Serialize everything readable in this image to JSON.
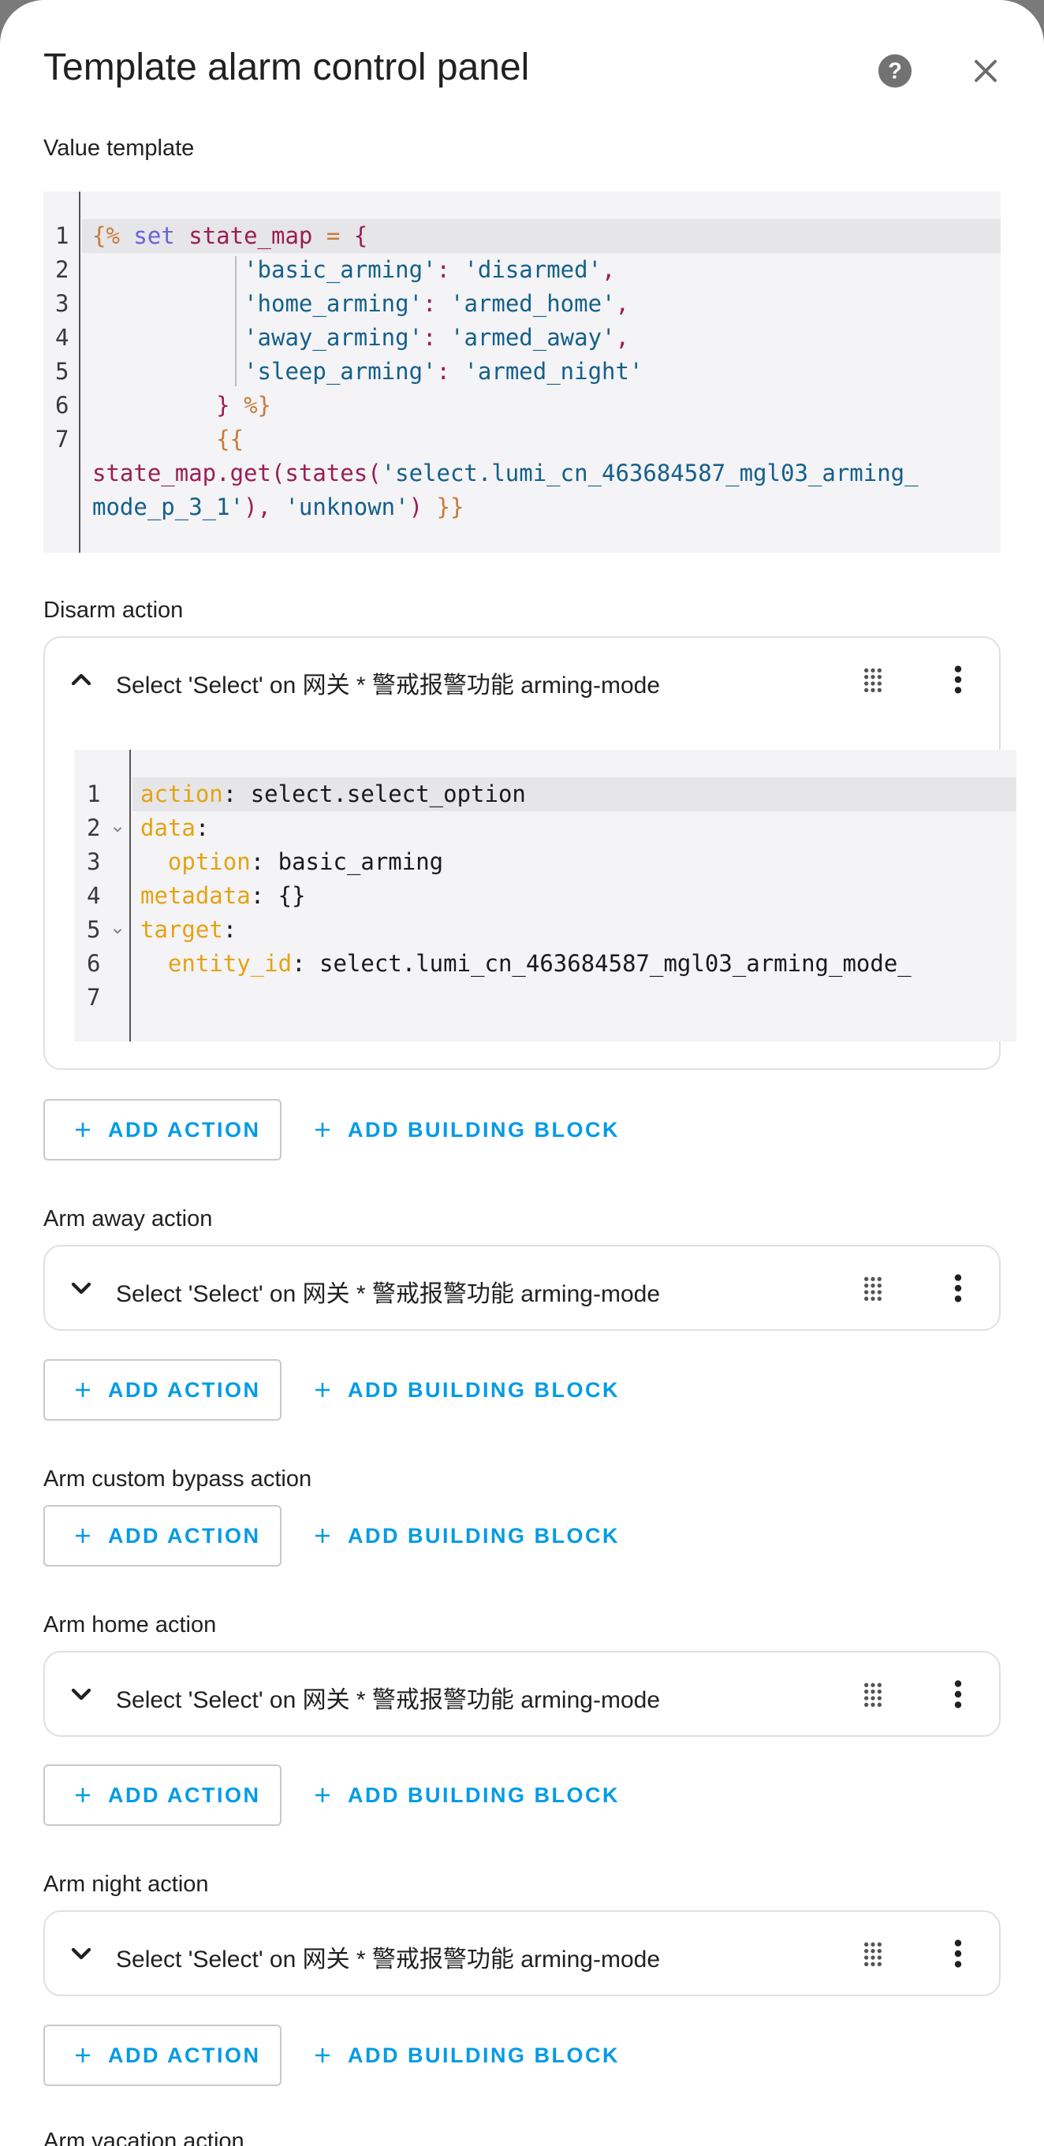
{
  "dialog": {
    "title": "Template alarm control panel"
  },
  "value_template": {
    "label": "Value template",
    "line_numbers": [
      "1",
      "2",
      "3",
      "4",
      "5",
      "6",
      "7"
    ]
  },
  "disarm": {
    "label": "Disarm action",
    "card_title": "Select 'Select' on 网关 * 警戒报警功能 arming-mode",
    "line_numbers": [
      "1",
      "2",
      "3",
      "4",
      "5",
      "6",
      "7"
    ],
    "yaml": {
      "l1_key": "action",
      "l1_val": " select.select_option",
      "l2_key": "data",
      "l3_key": "option",
      "l3_val": " basic_arming",
      "l4_key": "metadata",
      "l4_val": " {}",
      "l5_key": "target",
      "l6_key": "entity_id",
      "l6_val": " select.lumi_cn_463684587_mgl03_arming_mode_"
    }
  },
  "arm_away": {
    "label": "Arm away action",
    "card_title": "Select 'Select' on 网关 * 警戒报警功能 arming-mode"
  },
  "arm_custom_bypass": {
    "label": "Arm custom bypass action"
  },
  "arm_home": {
    "label": "Arm home action",
    "card_title": "Select 'Select' on 网关 * 警戒报警功能 arming-mode"
  },
  "arm_night": {
    "label": "Arm night action",
    "card_title": "Select 'Select' on 网关 * 警戒报警功能 arming-mode"
  },
  "arm_vacation": {
    "label": "Arm vacation action"
  },
  "buttons": {
    "add_action": "ADD ACTION",
    "add_building_block": "ADD BUILDING BLOCK"
  },
  "colors": {
    "accent": "#039be5",
    "jinja_delimiter": "#c77b3a",
    "jinja_keyword": "#6a62d8",
    "jinja_variable": "#9a1e55",
    "string": "#14608a",
    "yaml_key": "#e4a313"
  },
  "icons": {
    "help": "help-circle-icon",
    "close": "close-icon",
    "expand": "chevron-icon",
    "drag": "drag-handle-icon",
    "more": "dots-vertical-icon",
    "add": "plus-icon"
  }
}
